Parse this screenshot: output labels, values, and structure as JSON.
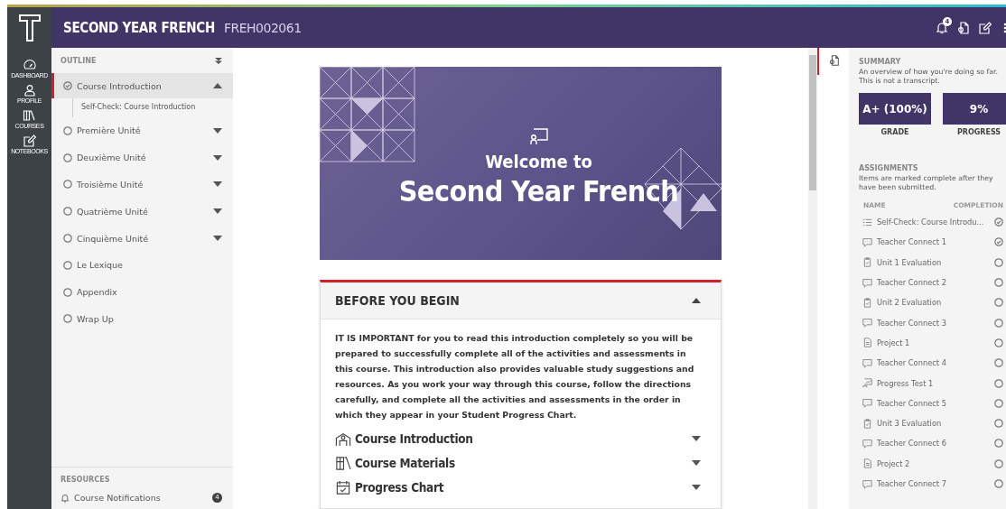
{
  "header": {
    "course_title": "SECOND YEAR FRENCH",
    "course_code": "FREH002061",
    "notification_count": "4"
  },
  "rail": [
    {
      "label": "DASHBOARD",
      "kind": "dashboard"
    },
    {
      "label": "PROFILE",
      "kind": "profile"
    },
    {
      "label": "COURSES",
      "kind": "courses"
    },
    {
      "label": "NOTEBOOKS",
      "kind": "notebooks"
    }
  ],
  "outline": {
    "title": "OUTLINE",
    "items": [
      {
        "label": "Course Introduction",
        "completed": true,
        "selected": true,
        "expanded": true,
        "children": [
          {
            "label": "Self-Check: Course Introduction"
          }
        ]
      },
      {
        "label": "Première Unité",
        "completed": false,
        "selected": false,
        "expanded": false
      },
      {
        "label": "Deuxième Unité",
        "completed": false,
        "selected": false,
        "expanded": false
      },
      {
        "label": "Troisième Unité",
        "completed": false,
        "selected": false,
        "expanded": false
      },
      {
        "label": "Quatrième Unité",
        "completed": false,
        "selected": false,
        "expanded": false
      },
      {
        "label": "Cinquième Unité",
        "completed": false,
        "selected": false,
        "expanded": false
      },
      {
        "label": "Le Lexique",
        "completed": false,
        "selected": false
      },
      {
        "label": "Appendix",
        "completed": false,
        "selected": false
      },
      {
        "label": "Wrap Up",
        "completed": false,
        "selected": false
      }
    ]
  },
  "resources": {
    "title": "RESOURCES",
    "items": [
      {
        "label": "Course Notifications",
        "count": "4"
      }
    ]
  },
  "hero": {
    "line_1": "Welcome to",
    "line_2": "Second Year French"
  },
  "section": {
    "title": "BEFORE YOU BEGIN",
    "expanded": true,
    "text": "IT IS IMPORTANT for you to read this introduction completely so you will be prepared to successfully complete all of the activities and assessments in this course. This introduction also provides valuable study suggestions and resources. As you work your way through this course, follow the directions carefully, and complete all the activities and assessments in the order in which they appear in your Student Progress Chart.",
    "items": [
      {
        "label": "Course Introduction",
        "kind": "intro",
        "expanded": false
      },
      {
        "label": "Course Materials",
        "kind": "materials",
        "expanded": false
      },
      {
        "label": "Progress Chart",
        "kind": "chart",
        "expanded": false
      }
    ]
  },
  "summary": {
    "title": "SUMMARY",
    "description": "An overview of how you're doing so far. This is not a transcript.",
    "stats": [
      {
        "value": "A+ (100%)",
        "label": "GRADE"
      },
      {
        "value": "9%",
        "label": "PROGRESS"
      }
    ]
  },
  "assignments": {
    "title": "ASSIGNMENTS",
    "description": "Items are marked complete after they have been submitted.",
    "columns": [
      "NAME",
      "COMPLETION"
    ],
    "rows": [
      {
        "name": "Self-Check: Course Introdu...",
        "kind": "checklist",
        "complete": true
      },
      {
        "name": "Teacher Connect 1",
        "kind": "chat",
        "complete": true
      },
      {
        "name": "Unit 1 Evaluation",
        "kind": "clipboard",
        "complete": false
      },
      {
        "name": "Teacher Connect 2",
        "kind": "chat",
        "complete": false
      },
      {
        "name": "Unit 2 Evaluation",
        "kind": "clipboard",
        "complete": false
      },
      {
        "name": "Teacher Connect 3",
        "kind": "chat",
        "complete": false
      },
      {
        "name": "Project 1",
        "kind": "document",
        "complete": false
      },
      {
        "name": "Teacher Connect 4",
        "kind": "chat",
        "complete": false
      },
      {
        "name": "Progress Test 1",
        "kind": "test",
        "complete": false
      },
      {
        "name": "Teacher Connect 5",
        "kind": "chat",
        "complete": false
      },
      {
        "name": "Unit 3 Evaluation",
        "kind": "clipboard",
        "complete": false
      },
      {
        "name": "Teacher Connect 6",
        "kind": "chat",
        "complete": false
      },
      {
        "name": "Project 2",
        "kind": "document",
        "complete": false
      },
      {
        "name": "Teacher Connect 7",
        "kind": "chat",
        "complete": false
      }
    ]
  }
}
